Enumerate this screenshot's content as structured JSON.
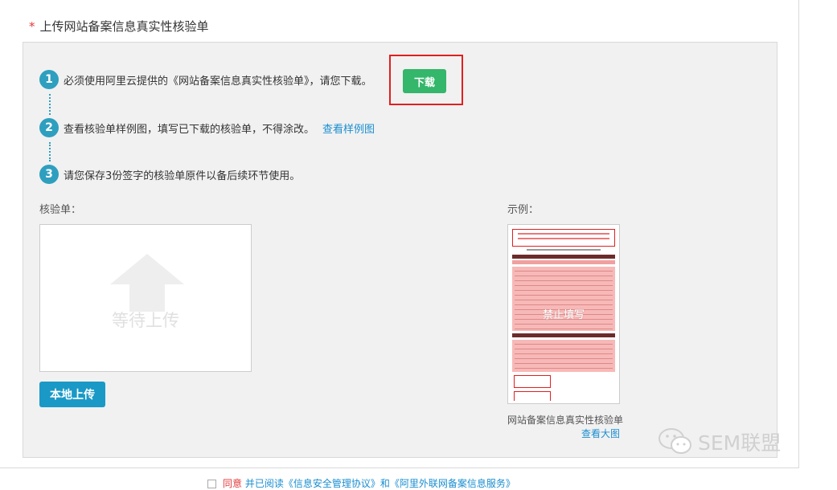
{
  "section": {
    "required_mark": "*",
    "title": "上传网站备案信息真实性核验单"
  },
  "steps": [
    {
      "num": "1",
      "text": "必须使用阿里云提供的《网站备案信息真实性核验单》，请您下载。",
      "button": "下载"
    },
    {
      "num": "2",
      "text": "查看核验单样例图，填写已下载的核验单，不得涂改。",
      "link": "查看样例图"
    },
    {
      "num": "3",
      "text": "请您保存3份签字的核验单原件以备后续环节使用。"
    }
  ],
  "upload": {
    "label": "核验单：",
    "placeholder": "等待上传",
    "button": "本地上传"
  },
  "sample": {
    "label": "示例：",
    "stamp": "禁止填写",
    "caption": "网站备案信息真实性核验单",
    "view_big": "查看大图"
  },
  "watermark": {
    "text": "SEM联盟"
  },
  "agreement": {
    "text_prefix": "同意",
    "text_mid": "并已阅读《信息安全管理协议》和《阿里外联网备案信息服务》"
  },
  "colors": {
    "accent": "#2e9fbf",
    "download_green": "#34b66b",
    "upload_blue": "#1a99c7",
    "link": "#1a8ed0",
    "highlight_red": "#e02020"
  }
}
